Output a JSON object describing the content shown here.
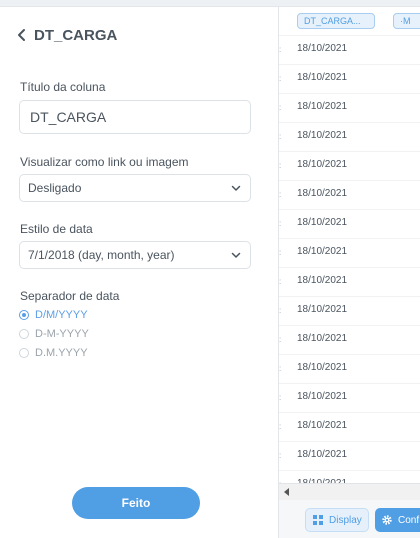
{
  "sidebar": {
    "title": "DT_CARGA",
    "column_title_label": "Título da coluna",
    "column_title_value": "DT_CARGA",
    "link_label": "Visualizar como link ou imagem",
    "link_value": "Desligado",
    "date_style_label": "Estilo de data",
    "date_style_value": "7/1/2018 (day, month, year)",
    "separator_label": "Separador de data",
    "separator_options": [
      {
        "label": "D/M/YYYY",
        "selected": true
      },
      {
        "label": "D-M-YYYY",
        "selected": false
      },
      {
        "label": "D.M.YYYY",
        "selected": false
      }
    ],
    "done_label": "Feito"
  },
  "table": {
    "headers": [
      "DT_CARGA...",
      "M"
    ],
    "row_value": "18/10/2021",
    "rows": [
      "18/10/2021",
      "18/10/2021",
      "18/10/2021",
      "18/10/2021",
      "18/10/2021",
      "18/10/2021",
      "18/10/2021",
      "18/10/2021",
      "18/10/2021",
      "18/10/2021",
      "18/10/2021",
      "18/10/2021",
      "18/10/2021",
      "18/10/2021",
      "18/10/2021",
      "18/10/2021"
    ]
  },
  "footer": {
    "display_label": "Display",
    "config_label": "Conf"
  },
  "colors": {
    "accent": "#509ee3",
    "text": "#4a545e"
  }
}
